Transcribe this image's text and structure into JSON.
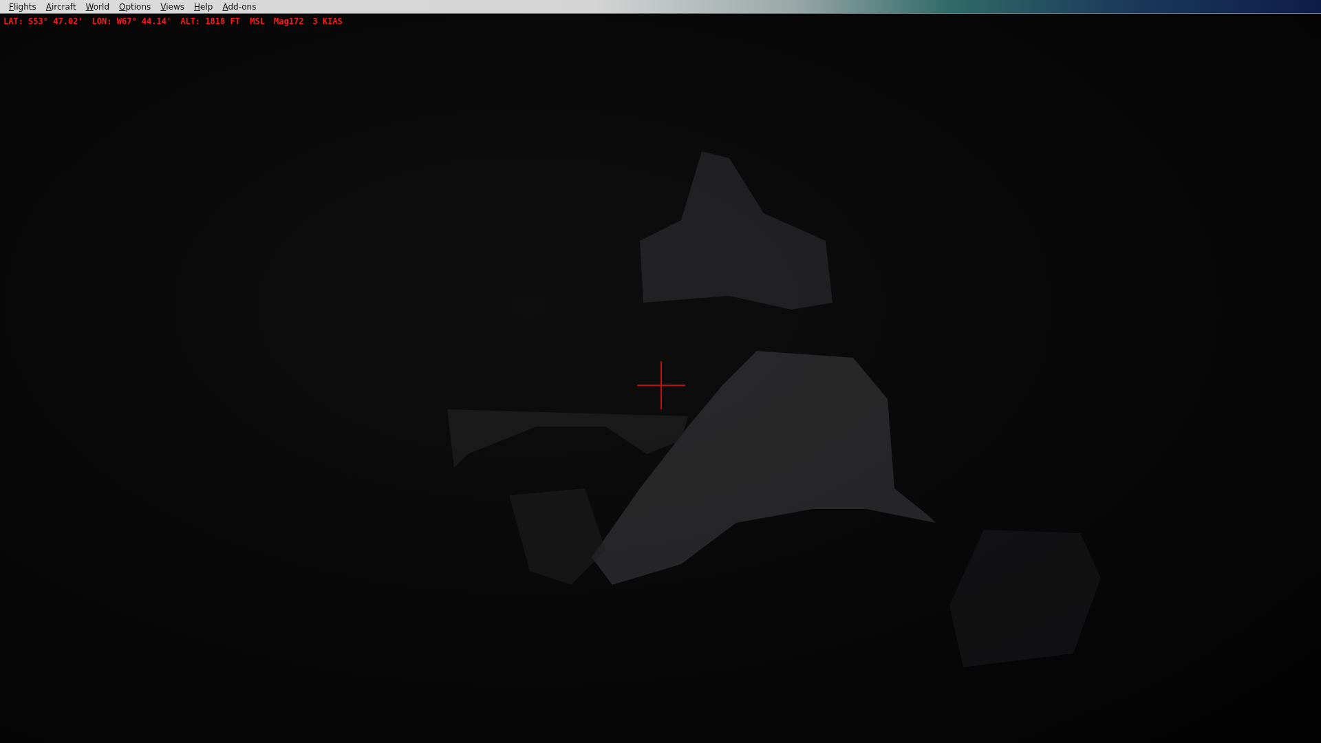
{
  "menu_bar": {
    "items": [
      "Flights",
      "Aircraft",
      "World",
      "Options",
      "Views",
      "Help",
      "Add-ons"
    ]
  },
  "status_line": {
    "fields": [
      "LAT: S53° 47.02'",
      "LON: W67° 44.14'",
      "ALT: 1818 FT  MSL",
      "Mag172",
      "3 KIAS"
    ]
  }
}
